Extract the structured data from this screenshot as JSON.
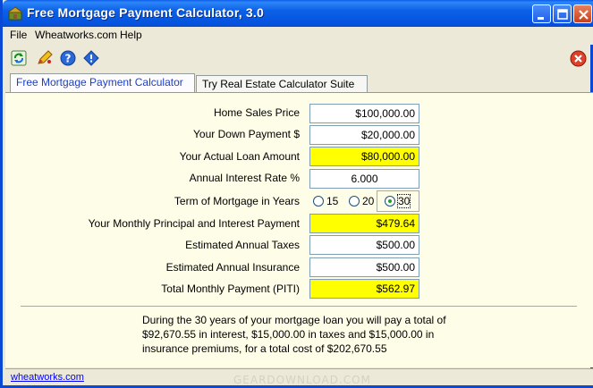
{
  "window": {
    "title": "Free Mortgage Payment Calculator, 3.0"
  },
  "menu": {
    "items": [
      "File",
      "Wheatworks.com",
      "Help"
    ]
  },
  "tabs": [
    {
      "label": "Free Mortgage Payment Calculator",
      "active": true
    },
    {
      "label": "Try Real Estate Calculator Suite",
      "active": false
    }
  ],
  "form": {
    "home_price_label": "Home Sales Price",
    "home_price": "$100,000.00",
    "down_payment_label": "Your Down Payment $",
    "down_payment": "$20,000.00",
    "loan_amount_label": "Your Actual Loan Amount",
    "loan_amount": "$80,000.00",
    "interest_label": "Annual Interest Rate %",
    "interest": "6.000",
    "term_label": "Term of Mortgage in Years",
    "term_options": [
      "15",
      "20",
      "30"
    ],
    "term_selected": "30",
    "pi_label": "Your Monthly Principal and Interest Payment",
    "pi": "$479.64",
    "taxes_label": "Estimated Annual Taxes",
    "taxes": "$500.00",
    "insurance_label": "Estimated Annual Insurance",
    "insurance": "$500.00",
    "piti_label": "Total Monthly Payment (PITI)",
    "piti": "$562.97"
  },
  "summary": {
    "line1": "During the 30 years of your mortgage loan you will pay a total of",
    "line2": "$92,670.55 in interest, $15,000.00 in taxes and $15,000.00 in",
    "line3": "insurance premiums, for a total cost of $202,670.55"
  },
  "status": {
    "link": "wheatworks.com"
  },
  "watermark": "GEARDOWNLOAD.COM",
  "colors": {
    "highlight": "#ffff00",
    "panel": "#fefde8",
    "titlebar": "#0a5be8"
  }
}
